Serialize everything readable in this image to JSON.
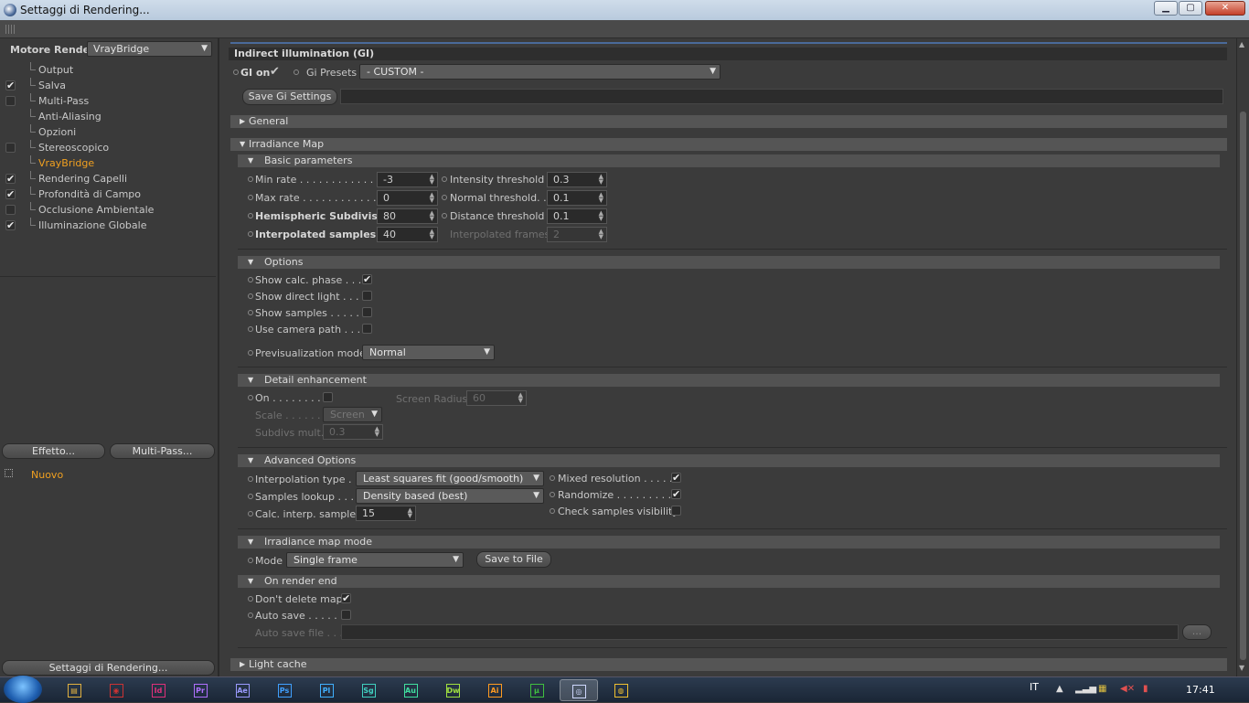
{
  "window": {
    "title": "Settaggi di Rendering...",
    "buttons": {
      "minimize": "▁",
      "maximize": "▢",
      "close": "✕"
    }
  },
  "sidebar": {
    "engine_label": "Motore Render",
    "engine_value": "VrayBridge",
    "items": [
      {
        "label": "Output",
        "checkbox": "none",
        "checked": false,
        "active": false
      },
      {
        "label": "Salva",
        "checkbox": "box",
        "checked": true,
        "active": false
      },
      {
        "label": "Multi-Pass",
        "checkbox": "box",
        "checked": false,
        "active": false
      },
      {
        "label": "Anti-Aliasing",
        "checkbox": "none",
        "checked": false,
        "active": false
      },
      {
        "label": "Opzioni",
        "checkbox": "none",
        "checked": false,
        "active": false
      },
      {
        "label": "Stereoscopico",
        "checkbox": "box",
        "checked": false,
        "active": false
      },
      {
        "label": "VrayBridge",
        "checkbox": "none",
        "checked": false,
        "active": true
      },
      {
        "label": "Rendering Capelli",
        "checkbox": "box",
        "checked": true,
        "active": false
      },
      {
        "label": "Profondità di Campo",
        "checkbox": "box",
        "checked": true,
        "active": false
      },
      {
        "label": "Occlusione Ambientale",
        "checkbox": "box",
        "checked": false,
        "active": false
      },
      {
        "label": "Illuminazione Globale",
        "checkbox": "box",
        "checked": true,
        "active": false
      }
    ],
    "effect_button": "Effetto...",
    "multipass_button": "Multi-Pass...",
    "new_item": "Nuovo",
    "settings_button": "Settaggi di Rendering..."
  },
  "main": {
    "section_title": "Indirect illumination (GI)",
    "gi_on_label": "GI on",
    "gi_on_checked": "✔",
    "gi_presets_label": "Gi Presets",
    "gi_presets_value": "- CUSTOM -",
    "save_gi_button": "Save Gi Settings",
    "general_header": "General",
    "irradiance_header": "Irradiance Map",
    "basic": {
      "header": "Basic parameters",
      "min_rate_label": "Min rate . . . . . . . . . . . . . . .",
      "min_rate": "-3",
      "max_rate_label": "Max rate . . . . . . . . . . . . . . .",
      "max_rate": "0",
      "hemi_label": "Hemispheric Subdivision",
      "hemi": "80",
      "interp_label": "Interpolated samples . . .",
      "interp": "40",
      "intensity_label": "Intensity threshold",
      "intensity": "0.3",
      "normal_label": "Normal threshold. .",
      "normal": "0.1",
      "distance_label": "Distance threshold",
      "distance": "0.1",
      "interp_frames_label": "Interpolated frames",
      "interp_frames": "2"
    },
    "options": {
      "header": "Options",
      "calc_phase_label": "Show calc. phase . . . .",
      "calc_phase": "✔",
      "direct_light_label": "Show direct light . . . .",
      "samples_label": "Show samples  . . . . . .",
      "camera_path_label": "Use camera path  . . . .",
      "previs_label": "Previsualization mode",
      "previs_value": "Normal"
    },
    "detail": {
      "header": "Detail enhancement",
      "on_label": "On . . . . . . . . . .",
      "screen_radius_label": "Screen Radius",
      "screen_radius": "60",
      "scale_label": "Scale . . . . . . .",
      "scale_value": "Screen",
      "subdivs_label": "Subdivs mult.",
      "subdivs": "0.3"
    },
    "advanced": {
      "header": "Advanced Options",
      "interp_type_label": "Interpolation type . .",
      "interp_type": "Least squares fit (good/smooth)",
      "lookup_label": "Samples lookup . . . .",
      "lookup": "Density based (best)",
      "calc_interp_label": "Calc. interp. samples",
      "calc_interp": "15",
      "mixed_label": "Mixed resolution . . . . .",
      "mixed": "✔",
      "randomize_label": "Randomize . . . . . . . . . .",
      "randomize": "✔",
      "check_vis_label": "Check samples visibility"
    },
    "mode": {
      "header": "Irradiance map mode",
      "mode_label": "Mode",
      "mode_value": "Single frame",
      "save_file_button": "Save to File"
    },
    "render_end": {
      "header": "On render end",
      "dont_delete_label": "Don't delete map",
      "dont_delete": "✔",
      "auto_save_label": "Auto save . . . . . .",
      "auto_save_file_label": "Auto save file . . .",
      "browse_button": "..."
    },
    "light_cache_header": "Light cache"
  },
  "taskbar": {
    "apps": [
      {
        "name": "explorer-icon",
        "glyph": "▤",
        "color": "#e0b040"
      },
      {
        "name": "camera-raw-icon",
        "glyph": "◉",
        "color": "#cc3333"
      },
      {
        "name": "indesign-icon",
        "glyph": "Id",
        "color": "#e0307a"
      },
      {
        "name": "premiere-icon",
        "glyph": "Pr",
        "color": "#b070ff"
      },
      {
        "name": "after-effects-icon",
        "glyph": "Ae",
        "color": "#9a9aff"
      },
      {
        "name": "photoshop-icon",
        "glyph": "Ps",
        "color": "#40a0ff"
      },
      {
        "name": "prelude-icon",
        "glyph": "Pl",
        "color": "#40b0ff"
      },
      {
        "name": "speedgrade-icon",
        "glyph": "Sg",
        "color": "#40d0c0"
      },
      {
        "name": "audition-icon",
        "glyph": "Au",
        "color": "#40e0a0"
      },
      {
        "name": "dreamweaver-icon",
        "glyph": "Dw",
        "color": "#a0e040"
      },
      {
        "name": "illustrator-icon",
        "glyph": "Ai",
        "color": "#ff9a20"
      },
      {
        "name": "utorrent-icon",
        "glyph": "µ",
        "color": "#40c040"
      },
      {
        "name": "cinema4d-icon",
        "glyph": "◎",
        "color": "#cfd8ff"
      },
      {
        "name": "chrome-icon",
        "glyph": "◍",
        "color": "#f0c030"
      }
    ],
    "lang": "IT",
    "clock": "17:41"
  },
  "colors": {
    "accent": "#f0a020",
    "panel": "#3b3b3b",
    "header": "#555555"
  }
}
